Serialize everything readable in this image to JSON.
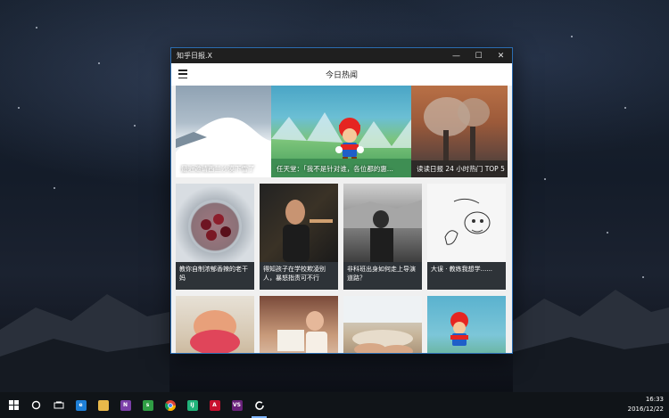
{
  "window": {
    "title": "知乎日报.X",
    "controls": {
      "minimize": "—",
      "maximize": "☐",
      "close": "✕"
    },
    "page_title": "今日热闻"
  },
  "banner": [
    {
      "caption": "最近邀请西兰沙漠下雪了",
      "image": "snow-dune"
    },
    {
      "caption": "任天堂：「我不是针对谁，各位都的惠...",
      "image": "mario"
    },
    {
      "caption": "读读日报 24 小时热门 TOP 5",
      "image": "factory-smoke"
    }
  ],
  "cards": [
    {
      "title": "教你自制浓郁香辣的老干妈",
      "image": "jar-of-sauce"
    },
    {
      "title": "得知孩子在学校欺凌别人，暴怒指责可不行",
      "image": "man-portrait"
    },
    {
      "title": "非科班出身如何走上导演道路？",
      "image": "photographer-bw"
    },
    {
      "title": "大误 · 教练我想学......",
      "image": "sketch-doodle"
    },
    {
      "title": "",
      "image": "ice-cream"
    },
    {
      "title": "",
      "image": "kid-reading"
    },
    {
      "title": "",
      "image": "hands-food"
    },
    {
      "title": "",
      "image": "mario"
    }
  ],
  "fab": {
    "icon": "refresh-icon"
  },
  "taskbar": {
    "apps": [
      "windows-start-icon",
      "cortana-icon",
      "task-view-icon",
      "edge-icon",
      "file-explorer-icon",
      "onenote-icon",
      "green-app-icon",
      "chrome-icon",
      "intellij-icon",
      "acrobat-icon",
      "visual-studio-icon",
      "zhihu-daily-icon"
    ],
    "time": "16:33",
    "date": "2016/12/22"
  },
  "colors": {
    "accent": "#2f8be6",
    "window_border": "#2b6cb0",
    "titlebar": "#1f1f1f"
  }
}
